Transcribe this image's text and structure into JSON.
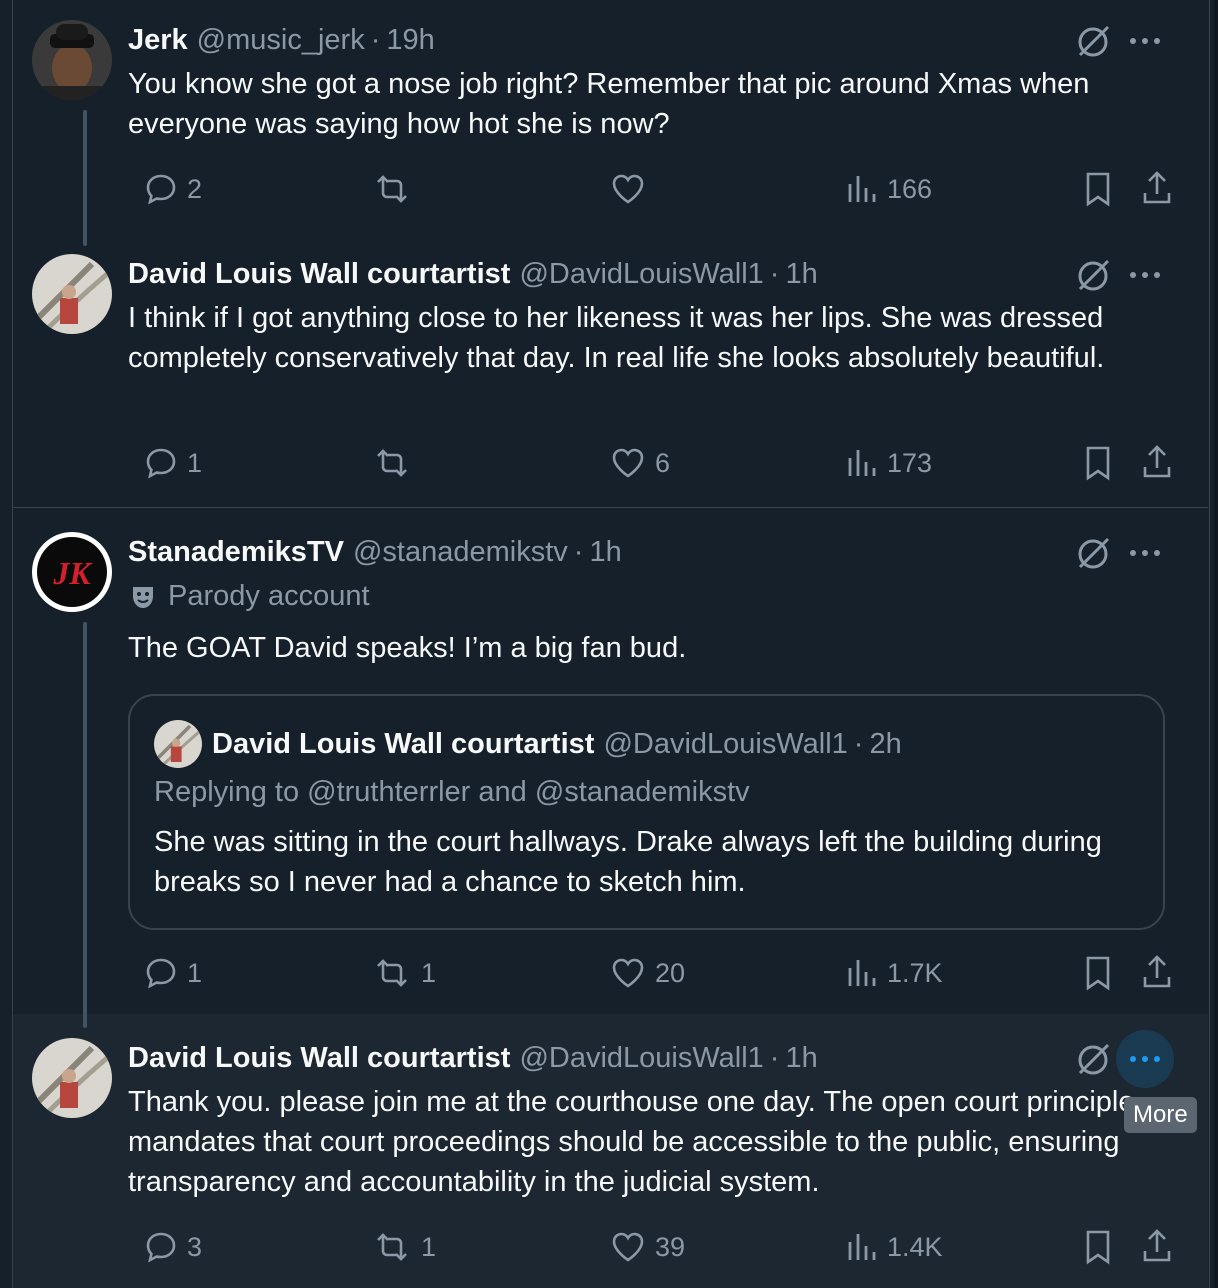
{
  "tweets": [
    {
      "name": "Jerk",
      "handle": "@music_jerk",
      "separator": "·",
      "time": "19h",
      "body": "You know she got a nose job right? Remember that pic around Xmas when everyone was saying how hot she is now?",
      "replies": "2",
      "retweets": "",
      "likes": "",
      "views": "166"
    },
    {
      "name": "David Louis Wall courtartist",
      "handle": "@DavidLouisWall1",
      "separator": "·",
      "time": "1h",
      "body": "I think if I got anything close to her likeness it was her lips. She was dressed completely conservatively that day.  In real life she looks absolutely beautiful.",
      "replies": "1",
      "retweets": "",
      "likes": "6",
      "views": "173"
    },
    {
      "name": "StanademiksTV",
      "handle": "@stanademikstv",
      "separator": "·",
      "time": "1h",
      "label": "Parody account",
      "body": "The GOAT David speaks! I’m a big fan bud.",
      "quote": {
        "name": "David Louis Wall courtartist",
        "handle": "@DavidLouisWall1",
        "separator": "·",
        "time": "2h",
        "replying": "Replying to @truthterrler and @stanademikstv",
        "body": "She was sitting in the court hallways. Drake always left the building during breaks so I never had a chance to sketch him."
      },
      "replies": "1",
      "retweets": "1",
      "likes": "20",
      "views": "1.7K"
    },
    {
      "name": "David Louis Wall courtartist",
      "handle": "@DavidLouisWall1",
      "separator": "·",
      "time": "1h",
      "body": "Thank you. please join me at the courthouse one day. The open court principle mandates that court proceedings should be accessible to the public, ensuring transparency and accountability in the judicial system.",
      "replies": "3",
      "retweets": "1",
      "likes": "39",
      "views": "1.4K",
      "tooltip": "More"
    }
  ],
  "colors": {
    "background": "#15202b",
    "hover": "#1c2732",
    "muted": "#8b98a5",
    "text": "#f7f9f9",
    "accent": "#1d9bf0",
    "border": "#38444d"
  },
  "icons": [
    "grok-icon",
    "more-icon",
    "reply-icon",
    "retweet-icon",
    "like-icon",
    "views-icon",
    "bookmark-icon",
    "share-icon",
    "parody-mask-icon"
  ]
}
